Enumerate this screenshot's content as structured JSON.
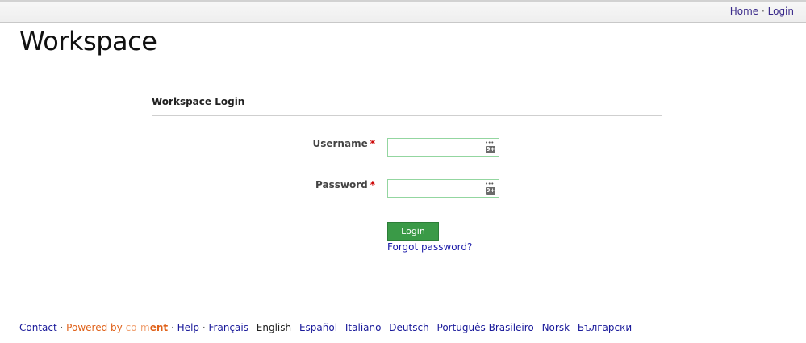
{
  "topnav": {
    "home": "Home",
    "separator": "·",
    "login": "Login"
  },
  "site": {
    "title": "Workspace"
  },
  "login_panel": {
    "heading": "Workspace Login",
    "username_label": "Username",
    "password_label": "Password",
    "required_marker": "*",
    "username_value": "",
    "password_value": "",
    "keyboard_badge": "9+",
    "keyboard_dots": "•••",
    "login_button": "Login",
    "forgot_password": "Forgot password?"
  },
  "footer": {
    "contact": "Contact",
    "separator": "·",
    "powered_by": "Powered by",
    "logo_part1": "co-m",
    "logo_part2": "ent",
    "help": "Help",
    "languages": [
      "Français",
      "English",
      "Español",
      "Italiano",
      "Deutsch",
      "Português Brasileiro",
      "Norsk",
      "Български"
    ],
    "current_language": "English"
  },
  "colors": {
    "button_green": "#3a9a47",
    "input_border": "#93d6a0",
    "link": "#1a1aa8",
    "powered_orange": "#e0621a",
    "required_red": "#cc0000"
  }
}
